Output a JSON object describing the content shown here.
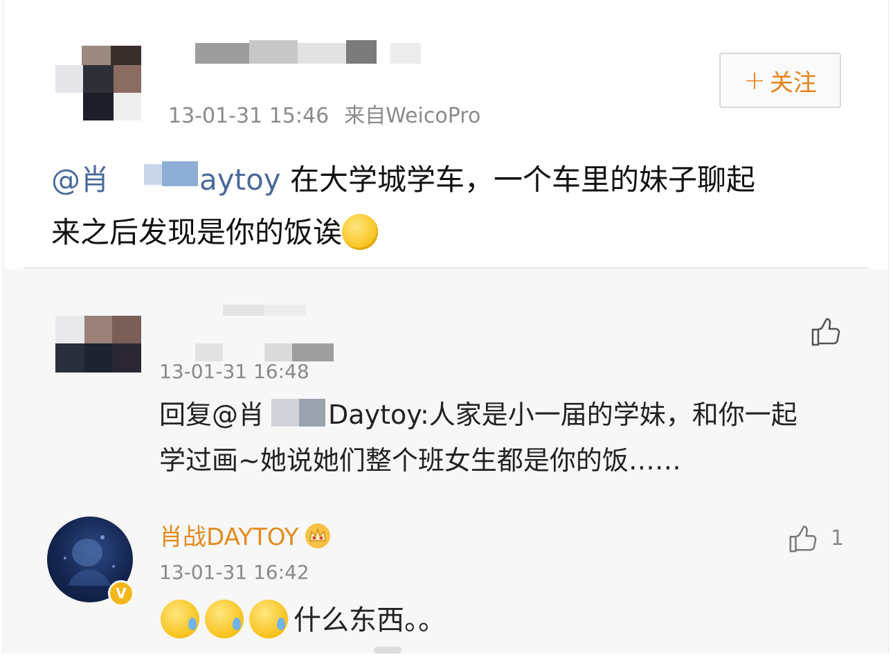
{
  "post": {
    "timestamp": "13-01-31 15:46",
    "source": "来自WeicoPro",
    "follow_label": "关注",
    "follow_plus": "+",
    "mention": "@肖",
    "mention_tail": "aytoy",
    "line1_rest": " 在大学城学车，一个车里的妹子聊起",
    "line2": "来之后发现是你的饭诶",
    "emoji": "smiling-thinking-emoji"
  },
  "comments": [
    {
      "timestamp": "13-01-31 16:48",
      "reply_prefix": "回复",
      "mention": "@肖",
      "mention_tail": "Daytoy",
      "line1_rest": ":人家是小一届的学妹，和你一起",
      "line2": "学过画~她说她们整个班女生都是你的饭……"
    },
    {
      "username": "肖战DAYTOY",
      "timestamp": "13-01-31 16:42",
      "like_count": "1",
      "text": "什么东西。。",
      "verified_mark": "V",
      "emoji": "sweat-emoji"
    }
  ],
  "colors": {
    "accent_orange": "#e8801a",
    "username_orange": "#e38a1d",
    "mention_blue": "#4b6a9c",
    "meta_gray": "#8a8a8a"
  }
}
